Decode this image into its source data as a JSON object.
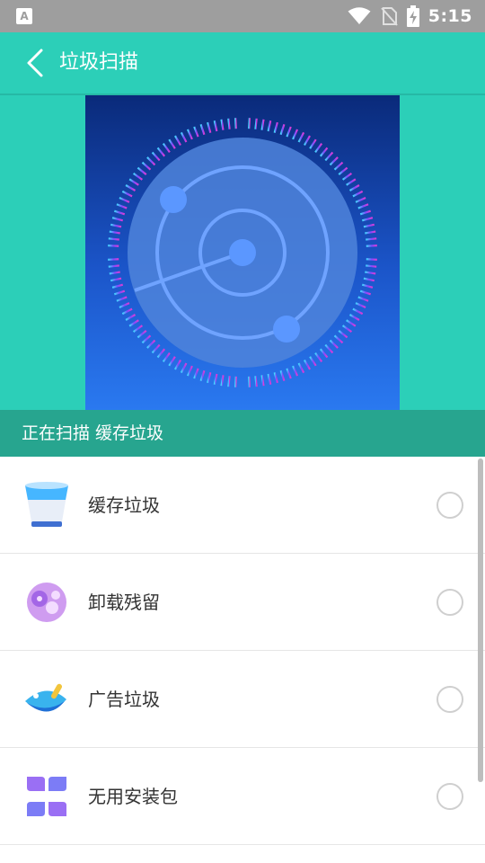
{
  "status_bar": {
    "time": "5:15",
    "app_icon_letter": "A",
    "icons": [
      "wifi-icon",
      "no-sim-icon",
      "battery-charging-icon"
    ]
  },
  "app_bar": {
    "title": "垃圾扫描",
    "back_icon": "chevron-left-icon"
  },
  "colors": {
    "primary": "#2ccfb8",
    "scan_bar": "#27a58f",
    "radar_top": "#0a2a7a",
    "radar_bottom": "#2a79f0",
    "ring_cyan": "#3fe0ff",
    "ring_magenta": "#e43bd0"
  },
  "scan_status": "正在扫描 缓存垃圾",
  "items": [
    {
      "label": "缓存垃圾",
      "icon": "cup-icon",
      "checked": false
    },
    {
      "label": "卸载残留",
      "icon": "gear-blob-icon",
      "checked": false
    },
    {
      "label": "广告垃圾",
      "icon": "ad-fish-icon",
      "checked": false
    },
    {
      "label": "无用安装包",
      "icon": "package-grid-icon",
      "checked": false
    }
  ]
}
